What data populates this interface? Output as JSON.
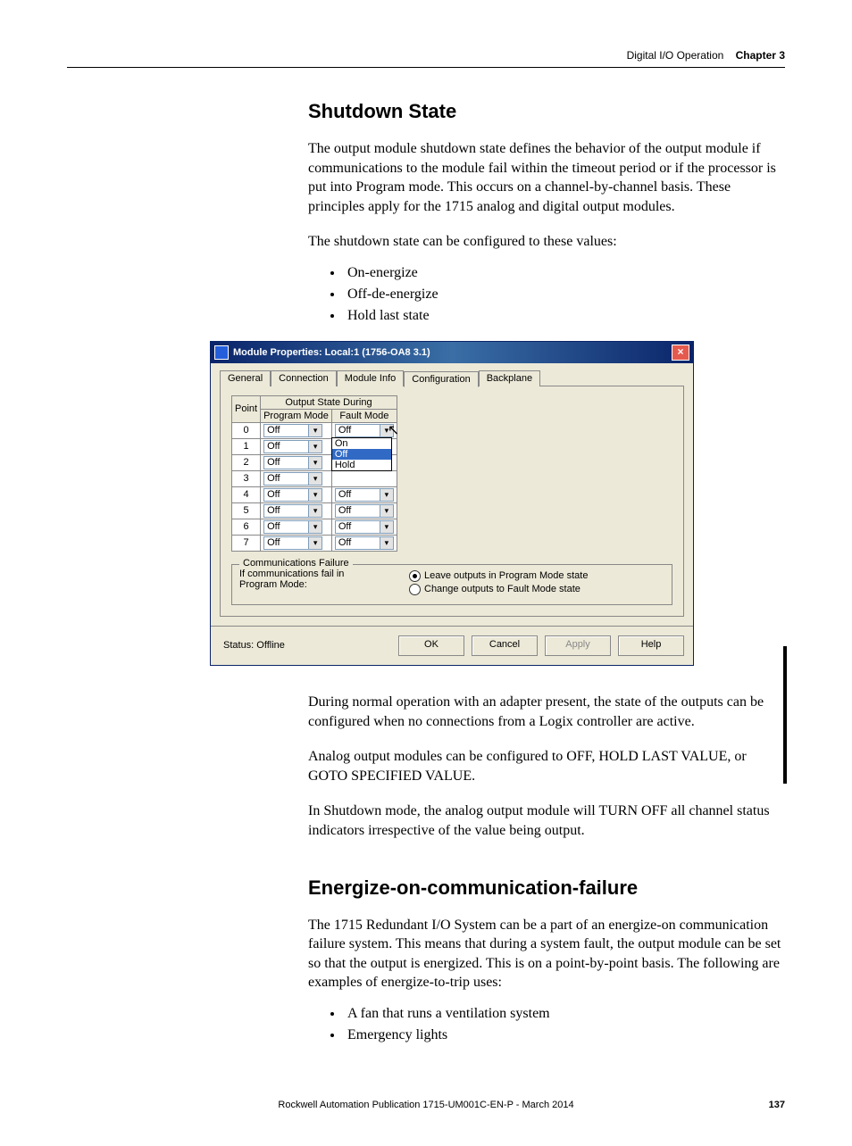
{
  "header": {
    "section": "Digital I/O Operation",
    "chapter": "Chapter 3"
  },
  "h1": "Shutdown State",
  "p1": "The output module shutdown state defines the behavior of the output module if communications to the module fail within the timeout period or if the processor is put into Program mode. This occurs on a channel-by-channel basis. These principles apply for the 1715 analog and digital output modules.",
  "p2": "The shutdown state can be configured to these values:",
  "list1": [
    "On-energize",
    "Off-de-energize",
    "Hold last state"
  ],
  "dialog": {
    "title": "Module Properties: Local:1 (1756-OA8 3.1)",
    "tabs": [
      "General",
      "Connection",
      "Module Info",
      "Configuration",
      "Backplane"
    ],
    "table": {
      "group_header": "Output State During",
      "col_point": "Point",
      "col_prog": "Program Mode",
      "col_fault": "Fault Mode",
      "rows": [
        {
          "pt": "0",
          "pm": "Off",
          "fm": "Off"
        },
        {
          "pt": "1",
          "pm": "Off",
          "fm": ""
        },
        {
          "pt": "2",
          "pm": "Off",
          "fm": ""
        },
        {
          "pt": "3",
          "pm": "Off",
          "fm": ""
        },
        {
          "pt": "4",
          "pm": "Off",
          "fm": "Off"
        },
        {
          "pt": "5",
          "pm": "Off",
          "fm": "Off"
        },
        {
          "pt": "6",
          "pm": "Off",
          "fm": "Off"
        },
        {
          "pt": "7",
          "pm": "Off",
          "fm": "Off"
        }
      ],
      "dropdown_options": [
        "On",
        "Off",
        "Hold"
      ]
    },
    "comm": {
      "legend": "Communications Failure",
      "left": "If communications fail in Program Mode:",
      "opt1": "Leave outputs in Program Mode state",
      "opt2": "Change outputs to Fault Mode state"
    },
    "status": "Status: Offline",
    "buttons": {
      "ok": "OK",
      "cancel": "Cancel",
      "apply": "Apply",
      "help": "Help"
    }
  },
  "p3": "During normal operation with an adapter present, the state of the outputs can be configured when no connections from a Logix controller are active.",
  "p4": "Analog output modules can be configured to OFF, HOLD LAST VALUE, or GOTO SPECIFIED VALUE.",
  "p5": "In Shutdown mode, the analog output module will TURN OFF all channel status indicators irrespective of the value being output.",
  "h2": "Energize-on-communication-failure",
  "p6": "The 1715 Redundant I/O System can be a part of an energize-on communication failure system. This means that during a system fault, the output module can be set so that the output is energized. This is on a point-by-point basis. The following are examples of energize-to-trip uses:",
  "list2": [
    "A fan that runs a ventilation system",
    "Emergency lights"
  ],
  "footer": {
    "pub": "Rockwell Automation Publication 1715-UM001C-EN-P - March 2014",
    "page": "137"
  }
}
